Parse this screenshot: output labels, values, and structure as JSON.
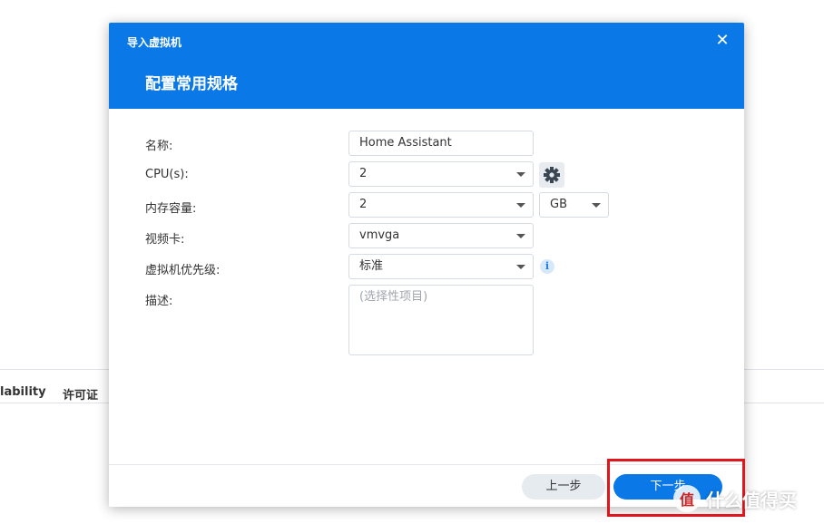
{
  "background": {
    "tabs": [
      "lability",
      "许可证"
    ]
  },
  "dialog": {
    "title": "导入虚拟机",
    "close_glyph": "✕",
    "heading": "配置常用规格",
    "form": {
      "name": {
        "label": "名称:",
        "value": "Home Assistant"
      },
      "cpu": {
        "label": "CPU(s):",
        "value": "2"
      },
      "memory": {
        "label": "内存容量:",
        "value": "2",
        "unit": "GB"
      },
      "video": {
        "label": "视频卡:",
        "value": "vmvga"
      },
      "priority": {
        "label": "虚拟机优先级:",
        "value": "标准",
        "info_glyph": "i"
      },
      "description": {
        "label": "描述:",
        "placeholder": "(选择性项目)"
      }
    },
    "footer": {
      "prev_label": "上一步",
      "next_label": "下一步"
    }
  },
  "watermark": {
    "logo_glyph": "值",
    "text": "什么值得买"
  },
  "colors": {
    "accent": "#0a78e6",
    "highlight": "#e0161c"
  }
}
